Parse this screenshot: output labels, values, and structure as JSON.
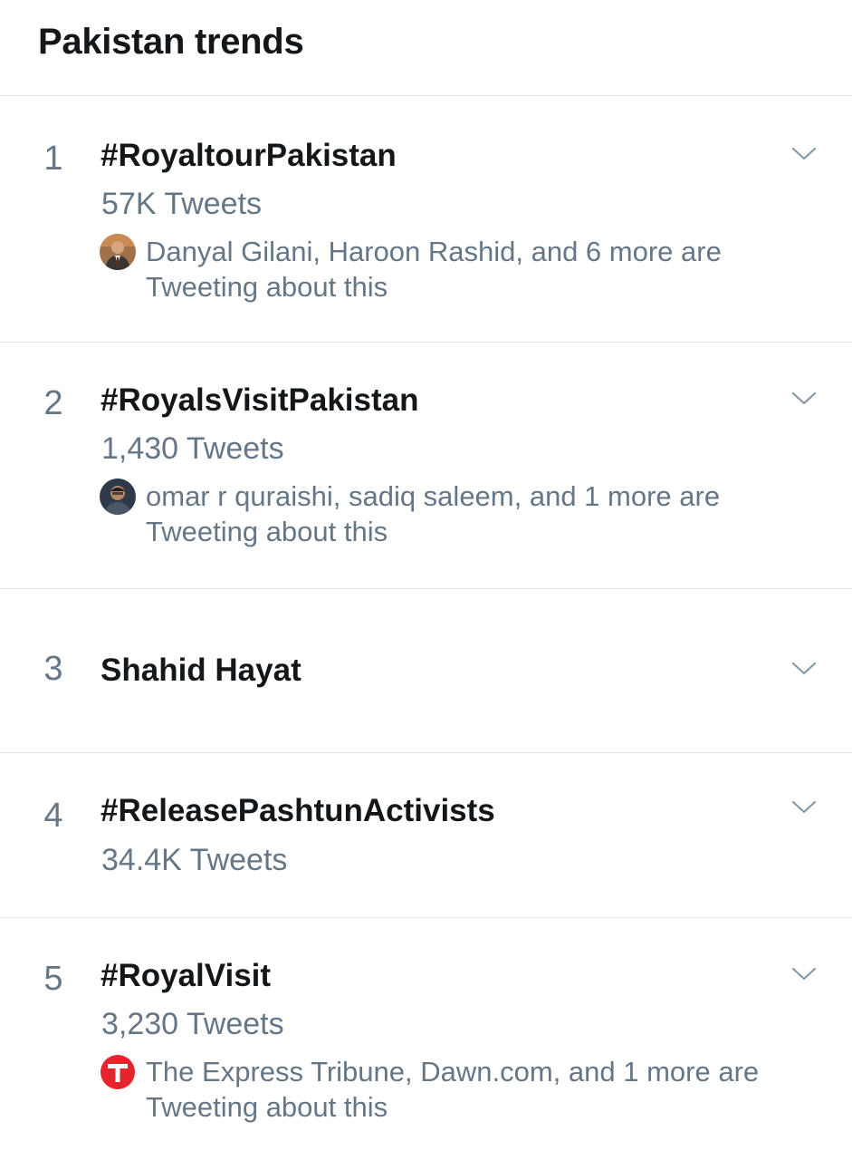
{
  "header": {
    "title": "Pakistan trends"
  },
  "trends": [
    {
      "rank": "1",
      "name": "#RoyaltourPakistan",
      "count": "57K Tweets",
      "context": "Danyal Gilani, Haroon Rashid, and 6 more are Tweeting about this",
      "avatar": "person-avatar"
    },
    {
      "rank": "2",
      "name": "#RoyalsVisitPakistan",
      "count": "1,430 Tweets",
      "context": "omar r quraishi, sadiq saleem, and 1 more are Tweeting about this",
      "avatar": "person-avatar"
    },
    {
      "rank": "3",
      "name": "Shahid Hayat"
    },
    {
      "rank": "4",
      "name": "#ReleasePashtunActivists",
      "count": "34.4K Tweets"
    },
    {
      "rank": "5",
      "name": "#RoyalVisit",
      "count": "3,230 Tweets",
      "context": "The Express Tribune, Dawn.com, and 1 more are Tweeting about this",
      "avatar": "express-tribune-logo"
    }
  ],
  "colors": {
    "text_primary": "#14171a",
    "text_secondary": "#657786",
    "divider": "#dfe3e6",
    "chevron": "#8899a6",
    "tribune_red": "#e5242b"
  },
  "icons": {
    "chevron": "chevron-down-icon"
  }
}
